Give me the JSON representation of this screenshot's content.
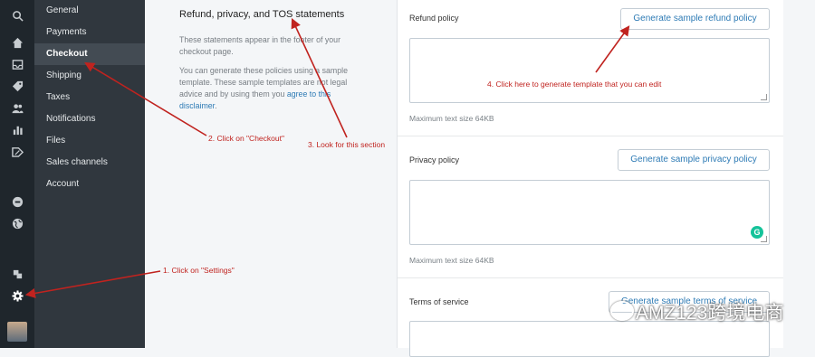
{
  "sidebar": {
    "items": [
      {
        "label": "General",
        "active": false
      },
      {
        "label": "Payments",
        "active": false
      },
      {
        "label": "Checkout",
        "active": true
      },
      {
        "label": "Shipping",
        "active": false
      },
      {
        "label": "Taxes",
        "active": false
      },
      {
        "label": "Notifications",
        "active": false
      },
      {
        "label": "Files",
        "active": false
      },
      {
        "label": "Sales channels",
        "active": false
      },
      {
        "label": "Account",
        "active": false
      }
    ]
  },
  "iconbar": {
    "icons": [
      "search-icon",
      "home-icon",
      "orders-icon",
      "tag-icon",
      "customers-icon",
      "analytics-icon",
      "discounts-icon",
      "apps-icon",
      "globe-icon",
      "plugin-icon",
      "settings-icon"
    ]
  },
  "section": {
    "title": "Refund, privacy, and TOS statements",
    "p1": "These statements appear in the footer of your checkout page.",
    "p2": "You can generate these policies using a sample template. These sample templates are not legal advice and by using them you",
    "link": "agree to this disclaimer",
    "p2_end": "."
  },
  "policies": {
    "refund": {
      "label": "Refund policy",
      "button": "Generate sample refund policy",
      "hint": "Maximum text size 64KB"
    },
    "privacy": {
      "label": "Privacy policy",
      "button": "Generate sample privacy policy",
      "hint": "Maximum text size 64KB"
    },
    "tos": {
      "label": "Terms of service",
      "button": "Generate sample terms of service"
    }
  },
  "annotations": {
    "a1": "1. Click on \"Settings\"",
    "a2": "2. Click on \"Checkout\"",
    "a3": "3. Look for this section",
    "a4": "4. Click here to generate template that you can edit"
  },
  "watermark": "AMZ123跨境电商",
  "colors": {
    "accent": "#2e7bb5",
    "annotation": "#c0231f",
    "sidebar_bg": "#30373e",
    "iconbar_bg": "#1f262c"
  }
}
